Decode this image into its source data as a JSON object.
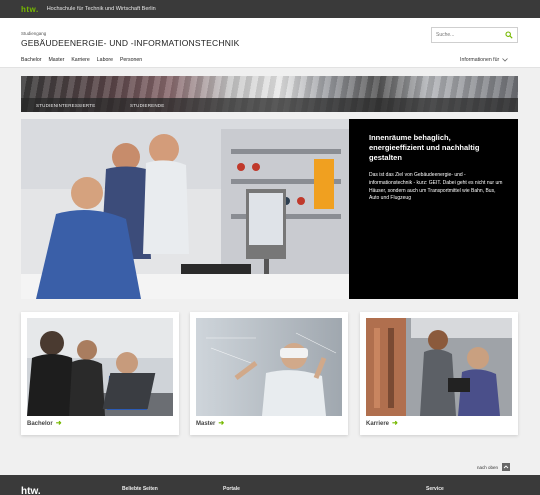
{
  "topbar": {
    "logo": "htw.",
    "institution": "Hochschule für Technik und Wirtschaft Berlin"
  },
  "header": {
    "kicker": "Studiengang",
    "title": "GEBÄUDEENERGIE- UND -INFORMATIONSTECHNIK",
    "search_placeholder": "Suche...",
    "info_for": "Informationen für"
  },
  "nav": {
    "items": [
      "Bachelor",
      "Master",
      "Karriere",
      "Labore",
      "Personen"
    ]
  },
  "banner": {
    "labels": [
      "STUDIENINTERESSIERTE",
      "STUDIERENDE"
    ]
  },
  "hero": {
    "headline": "Innenräume behaglich, energieeffizient und nachhaltig gestalten",
    "body": "Das ist das Ziel von Gebäudeenergie- und -informationstechnik  - kurz: GEIT. Dabei geht es nicht nur um Häuser, sondern auch um Transportmittel wie Bahn, Bus, Auto und Flugzeug"
  },
  "cards": [
    {
      "label": "Bachelor"
    },
    {
      "label": "Master"
    },
    {
      "label": "Karriere"
    }
  ],
  "to_top": "nach oben",
  "footer": {
    "logo": "htw.",
    "headings": [
      "Beliebte Seiten",
      "Portale",
      "Service"
    ]
  },
  "colors": {
    "accent": "#76b900",
    "dark": "#3a3a3a"
  }
}
